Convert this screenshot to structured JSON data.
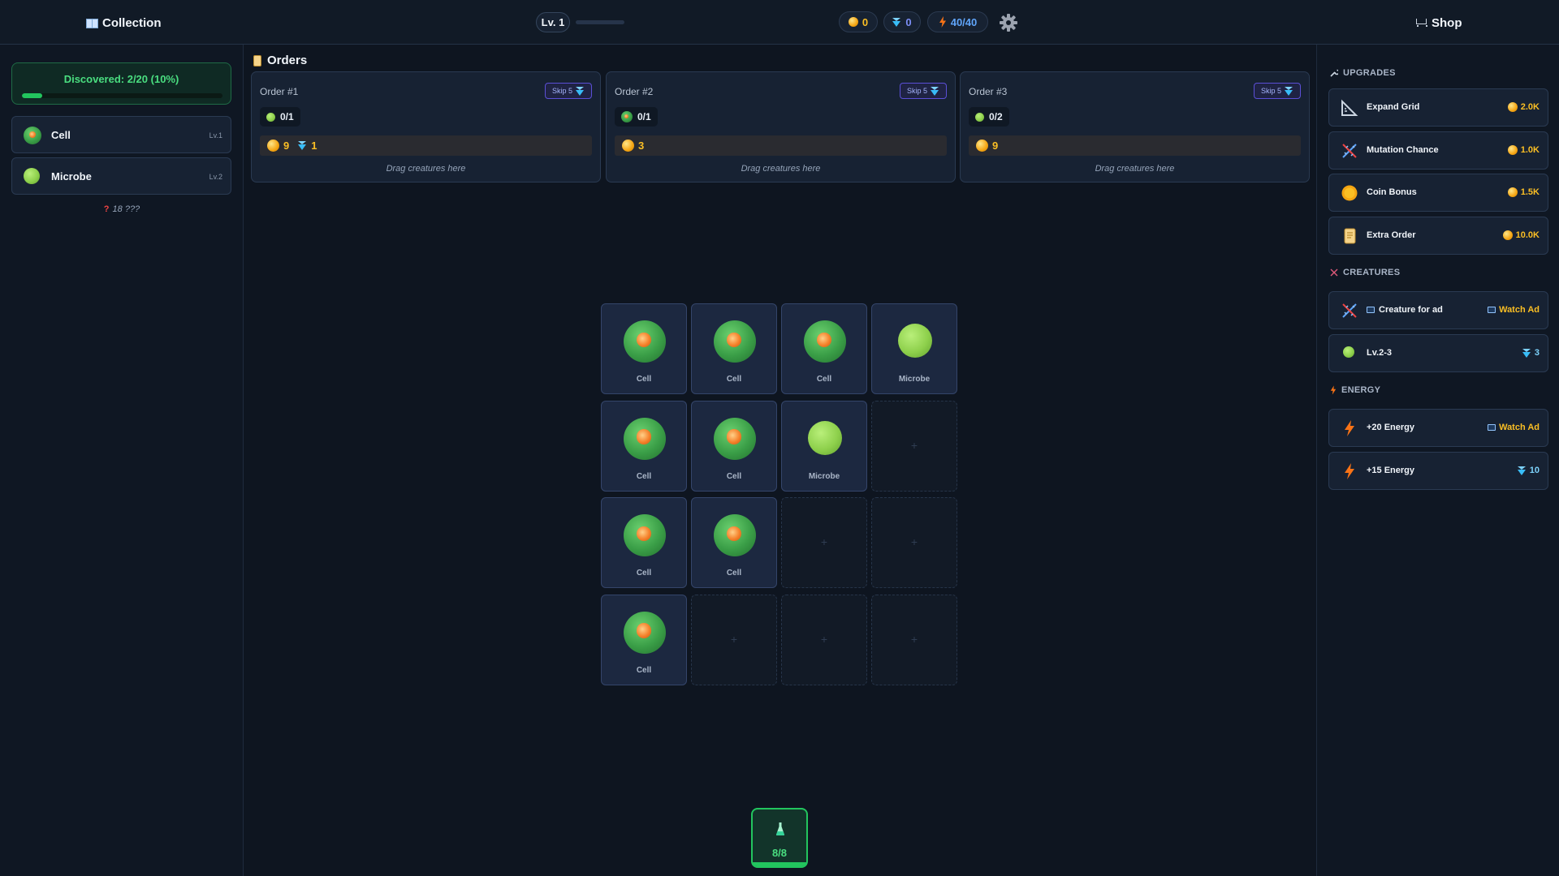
{
  "topbar": {
    "collection_label": "Collection",
    "level_label": "Lv. 1",
    "xp_progress": 0,
    "coins": "0",
    "gems": "0",
    "energy": "40/40",
    "shop_label": "Shop"
  },
  "collection": {
    "discovered_label": "Discovered: 2/20 (10%)",
    "discovered_fraction": 0.1,
    "items": [
      {
        "name": "Cell",
        "level": "Lv.1"
      },
      {
        "name": "Microbe",
        "level": "Lv.2"
      }
    ],
    "unknown_label": "18 ???"
  },
  "orders": {
    "title": "Orders",
    "list": [
      {
        "title": "Order #1",
        "skip_label": "Skip 5",
        "req_count": "0/1",
        "req_creature": "microbe",
        "reward_coins": "9",
        "reward_gems": "1",
        "hint": "Drag creatures here"
      },
      {
        "title": "Order #2",
        "skip_label": "Skip 5",
        "req_count": "0/1",
        "req_creature": "cell",
        "reward_coins": "3",
        "hint": "Drag creatures here"
      },
      {
        "title": "Order #3",
        "skip_label": "Skip 5",
        "req_count": "0/2",
        "req_creature": "microbe",
        "reward_coins": "9",
        "hint": "Drag creatures here"
      }
    ]
  },
  "grid": {
    "tiles": [
      {
        "type": "cell",
        "label": "Cell"
      },
      {
        "type": "cell",
        "label": "Cell"
      },
      {
        "type": "cell",
        "label": "Cell"
      },
      {
        "type": "microbe",
        "label": "Microbe"
      },
      {
        "type": "cell",
        "label": "Cell"
      },
      {
        "type": "cell",
        "label": "Cell"
      },
      {
        "type": "microbe",
        "label": "Microbe"
      },
      {
        "type": "empty",
        "label": "+"
      },
      {
        "type": "cell",
        "label": "Cell"
      },
      {
        "type": "cell",
        "label": "Cell"
      },
      {
        "type": "empty",
        "label": "+"
      },
      {
        "type": "empty",
        "label": "+"
      },
      {
        "type": "cell",
        "label": "Cell"
      },
      {
        "type": "empty",
        "label": "+"
      },
      {
        "type": "empty",
        "label": "+"
      },
      {
        "type": "empty",
        "label": "+"
      }
    ]
  },
  "spawn": {
    "count_label": "8/8",
    "fraction": 1
  },
  "shop": {
    "upgrades_title": "UPGRADES",
    "upgrades": [
      {
        "name": "Expand Grid",
        "price": "2.0K",
        "icon": "ruler-icon"
      },
      {
        "name": "Mutation Chance",
        "price": "1.0K",
        "icon": "dna-icon"
      },
      {
        "name": "Coin Bonus",
        "price": "1.5K",
        "icon": "coin-icon"
      },
      {
        "name": "Extra Order",
        "price": "10.0K",
        "icon": "scroll-icon"
      }
    ],
    "creatures_title": "CREATURES",
    "creatures": [
      {
        "name": "Creature for ad",
        "price": "Watch Ad",
        "icon": "dna-icon"
      },
      {
        "name": "Lv.2-3",
        "price": "3",
        "icon": "microbe-icon"
      }
    ],
    "energy_title": "ENERGY",
    "energy": [
      {
        "name": "+20 Energy",
        "price": "Watch Ad",
        "icon": "bolt-icon"
      },
      {
        "name": "+15 Energy",
        "price": "10",
        "icon": "bolt-icon"
      }
    ]
  },
  "colors": {
    "background": "#0e1520",
    "accent_green": "#22c55e",
    "coin_gold": "#fbbf24",
    "gem_blue": "#38bdf8",
    "energy_orange": "#f97316"
  }
}
